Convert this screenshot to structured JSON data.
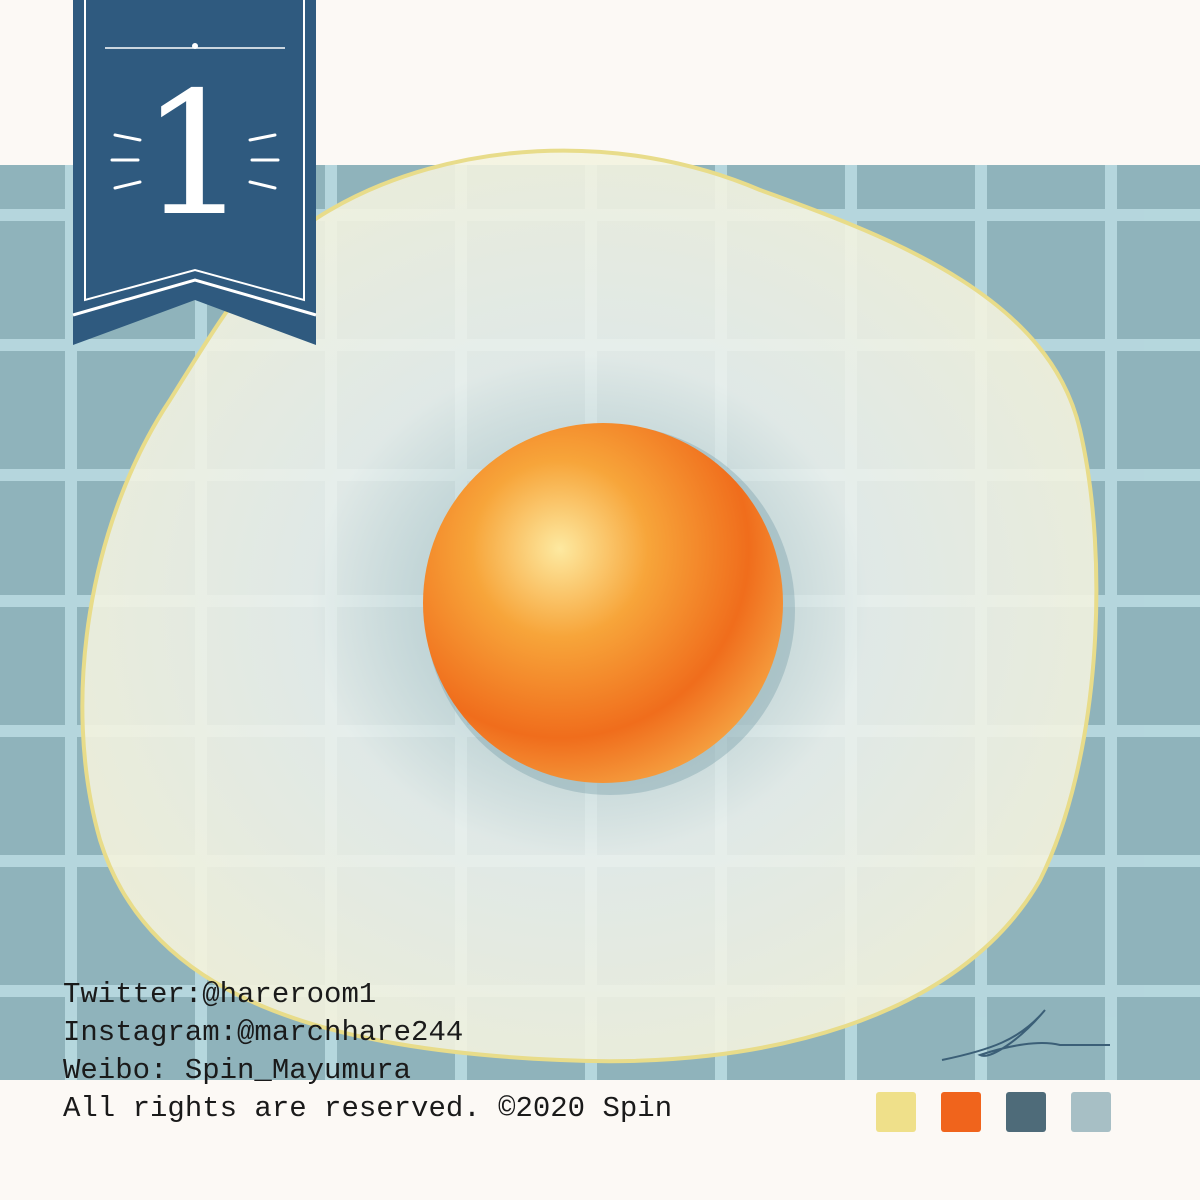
{
  "banner": {
    "number": "1",
    "color": "#2f5a7f"
  },
  "colors": {
    "background": "#fcf9f5",
    "tablecloth": "#8fb3bb",
    "grid_line": "#bcdde3",
    "egg_white": "#eef2ee",
    "yolk": "#f07a22"
  },
  "credits": {
    "twitter": "Twitter:@hareroom1",
    "instagram": "Instagram:@marchhare244",
    "weibo": "Weibo: Spin_Mayumura",
    "copyright": "All rights are reserved. ©2020 Spin"
  },
  "signature": "Spin",
  "palette": [
    "#efe08a",
    "#f0641c",
    "#4e6b79",
    "#a7bfc5"
  ]
}
